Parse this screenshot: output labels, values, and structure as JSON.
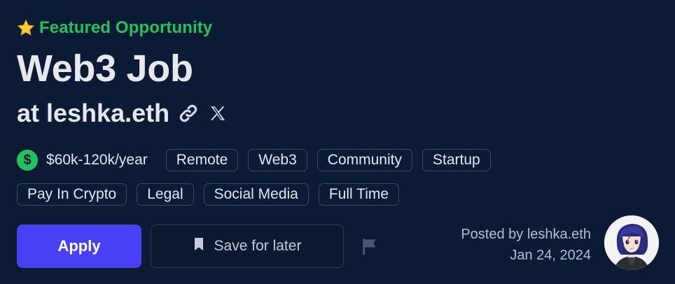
{
  "featured": {
    "icon": "star-icon",
    "label": "Featured Opportunity",
    "color": "#25c25a"
  },
  "job": {
    "title": "Web3 Job",
    "company": "at leshka.eth",
    "link_icon": "link-icon",
    "social_icon": "x-icon"
  },
  "salary": {
    "icon": "dollar-icon",
    "value": "$60k-120k/year"
  },
  "tags_row1": [
    "Remote",
    "Web3",
    "Community",
    "Startup"
  ],
  "tags_row2": [
    "Pay In Crypto",
    "Legal",
    "Social Media",
    "Full Time"
  ],
  "actions": {
    "apply_label": "Apply",
    "save_label": "Save for later",
    "save_icon": "bookmark-icon",
    "flag_icon": "flag-icon"
  },
  "posted": {
    "by": "Posted by leshka.eth",
    "date": "Jan 24, 2024"
  },
  "colors": {
    "background": "#0b1b36",
    "accent": "#4840f5",
    "green": "#25c25a",
    "tag_border": "#3a4a66"
  }
}
